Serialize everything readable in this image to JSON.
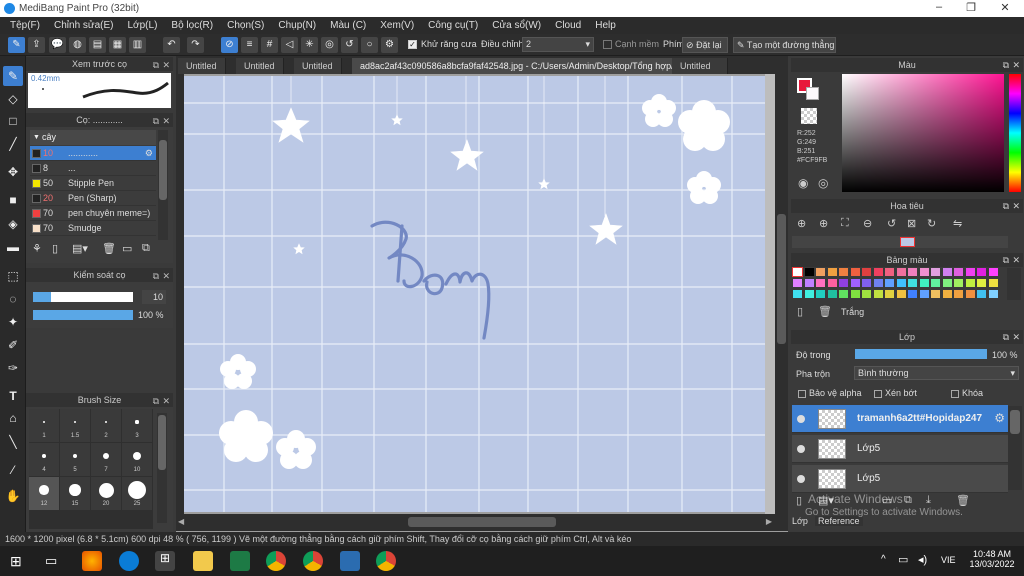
{
  "window": {
    "title": "MediBang Paint Pro (32bit)"
  },
  "menu": [
    "Tệp(F)",
    "Chỉnh sửa(E)",
    "Lớp(L)",
    "Bộ lọc(R)",
    "Chọn(S)",
    "Chụp(N)",
    "Màu (C)",
    "Xem(V)",
    "Công cụ(T)",
    "Cửa sổ(W)",
    "Cloud",
    "Help"
  ],
  "toolbar": {
    "antialias_label": "Khử răng cưa",
    "adjust_label": "Điều chỉnh",
    "adjust_value": "2",
    "smooth_label": "Cạnh mềm",
    "key_label": "Phím",
    "reset_label": "Đặt lại",
    "straight_label": "Tạo một đường thẳng"
  },
  "doc_tabs": [
    "Untitled",
    "Untitled",
    "Untitled",
    "ad8ac2af43c090586a8bcfa9faf42548.jpg - C:/Users/Admin/Desktop/Tổng hợp/ảnh=)))",
    "Untitled"
  ],
  "brush_preview": {
    "title": "Xem trước cọ",
    "size_text": "0.42mm"
  },
  "brush_panel": {
    "title": "Cọ: ............",
    "group": "cây",
    "items": [
      {
        "size": "10",
        "name": "............",
        "color": "#222222"
      },
      {
        "size": "8",
        "name": "...",
        "color": "#222222"
      },
      {
        "size": "50",
        "name": "Stipple Pen",
        "color": "#f3e600"
      },
      {
        "size": "20",
        "name": "Pen (Sharp)",
        "color": "#222222"
      },
      {
        "size": "70",
        "name": "pen chuyên meme=)",
        "color": "#f04040"
      },
      {
        "size": "70",
        "name": "Smudge",
        "color": "#f8e0c8"
      }
    ]
  },
  "brush_control": {
    "title": "Kiểm soát cọ",
    "size_value": "10",
    "opacity_value": "100 %",
    "opacity_percent": 100
  },
  "brush_size": {
    "title": "Brush Size",
    "sizes": [
      "1",
      "1.5",
      "2",
      "3",
      "4",
      "5",
      "7",
      "10",
      "12",
      "15",
      "20",
      "25"
    ]
  },
  "color_panel": {
    "title": "Màu",
    "r": "R:252",
    "g": "G:249",
    "b": "B:251",
    "hex": "#FCF9FB",
    "primary": "#e8183a",
    "secondary": "#fcf9fb"
  },
  "navigator": {
    "title": "Hoa tiêu"
  },
  "palette": {
    "title": "Bảng màu",
    "name": "Trắng"
  },
  "layers": {
    "title": "Lớp",
    "opacity_label": "Độ trong",
    "opacity_value": "100 %",
    "blend_label": "Pha trộn",
    "blend_value": "Bình thường",
    "protect_alpha": "Bảo vệ alpha",
    "clipping": "Xén bớt",
    "lock": "Khóa",
    "items": [
      {
        "name": "tramanh6a2tt#Hopidap247",
        "active": true
      },
      {
        "name": "Lớp5",
        "active": false
      },
      {
        "name": "Lớp5",
        "active": false
      }
    ],
    "tabs": [
      "Lớp",
      "Reference"
    ]
  },
  "activate_windows": {
    "line1": "Activate Windows",
    "line2": "Go to Settings to activate Windows."
  },
  "status": "1600 * 1200 pixel  (6.8 * 5.1cm)  600 dpi  48 %  ( 756, 1199 )  Vẽ một đường thẳng bằng cách giữ phím Shift, Thay đổi cỡ cọ bằng cách giữ phím Ctrl, Alt và kéo",
  "canvas_text": "Bom",
  "taskbar": {
    "lang": "VIE",
    "time": "10:48 AM",
    "date": "13/03/2022"
  }
}
